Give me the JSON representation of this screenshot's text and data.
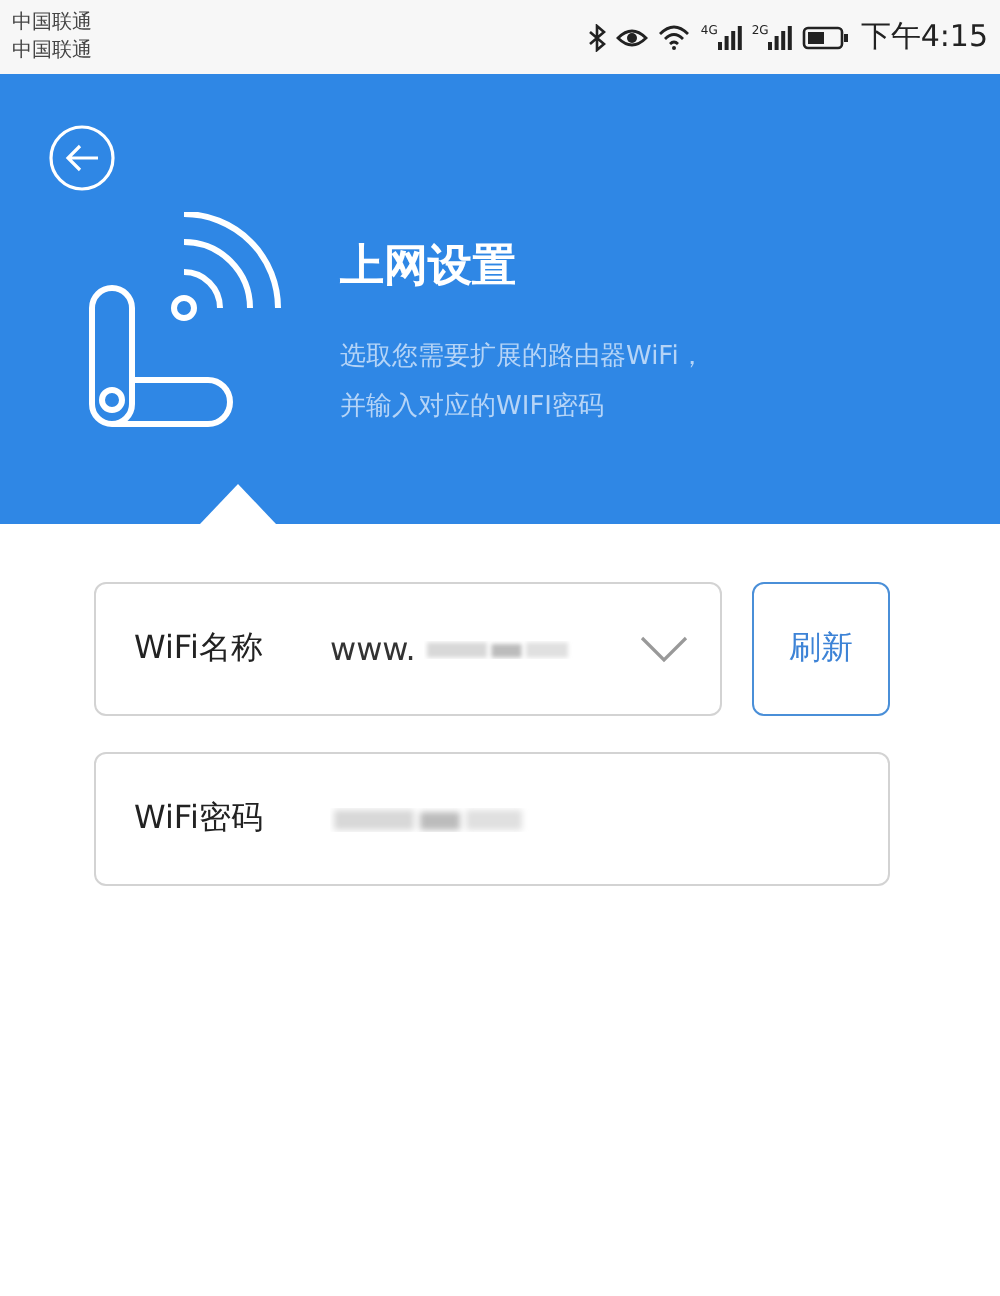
{
  "status_bar": {
    "carriers": [
      "中国联通",
      "中国联通"
    ],
    "network_labels": [
      "4G",
      "2G"
    ],
    "time": "下午4:15"
  },
  "header": {
    "title": "上网设置",
    "subtitle_lines": [
      "选取您需要扩展的路由器WiFi，",
      "并输入对应的WIFI密码"
    ]
  },
  "form": {
    "fields": [
      {
        "kind": "dropdown",
        "label": "WiFi名称",
        "value": "www.",
        "blurred": true
      },
      {
        "kind": "password",
        "label": "WiFi密码",
        "blurred": true
      }
    ],
    "refresh_button": "刷新"
  }
}
